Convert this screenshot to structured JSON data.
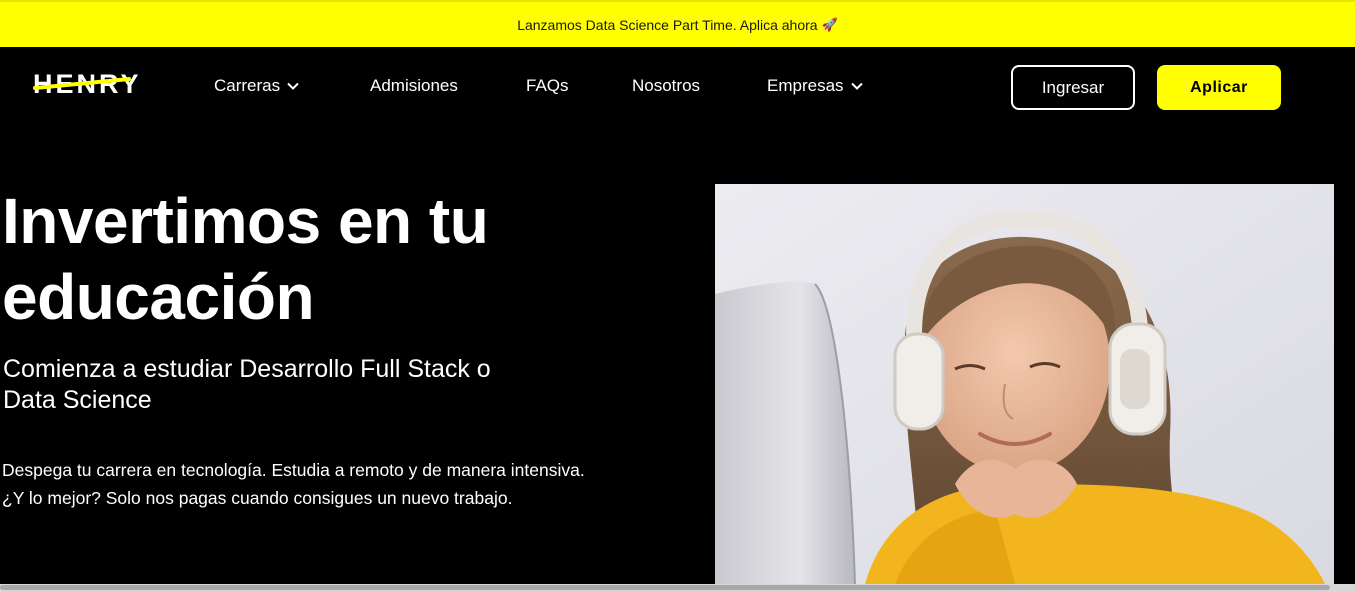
{
  "promo": {
    "text": "Lanzamos Data Science Part Time. Aplica ahora",
    "icon": "rocket-icon"
  },
  "nav": {
    "logo": "HENRY",
    "items": [
      {
        "label": "Carreras",
        "has_dropdown": true
      },
      {
        "label": "Admisiones",
        "has_dropdown": false
      },
      {
        "label": "FAQs",
        "has_dropdown": false
      },
      {
        "label": "Nosotros",
        "has_dropdown": false
      },
      {
        "label": "Empresas",
        "has_dropdown": true
      }
    ],
    "login_label": "Ingresar",
    "apply_label": "Aplicar"
  },
  "hero": {
    "title_line1": "Invertimos en tu",
    "title_line2": "educación",
    "subtitle_line1": "Comienza a estudiar Desarrollo Full Stack o",
    "subtitle_line2": "Data Science",
    "desc_line1": "Despega tu carrera en tecnología. Estudia a remoto y de manera intensiva.",
    "desc_line2": "¿Y lo mejor? Solo nos pagas cuando consigues un nuevo trabajo."
  },
  "colors": {
    "accent": "#ffff01",
    "background": "#000000",
    "text": "#ffffff"
  }
}
